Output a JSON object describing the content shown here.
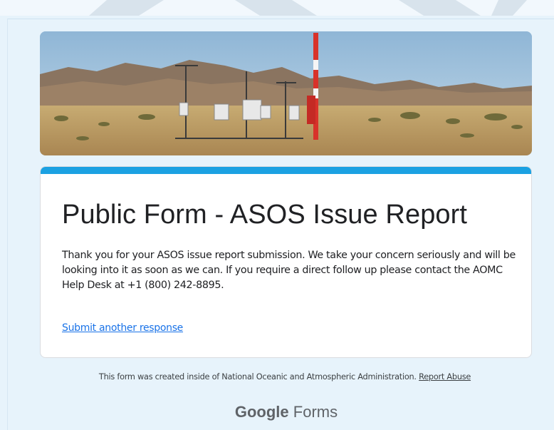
{
  "form": {
    "title": "Public Form - ASOS Issue Report",
    "confirmation_message": "Thank you for your ASOS issue report submission. We take your concern seriously and will be looking into it as soon as we can. If you require a direct follow up please contact the AOMC Help Desk at +1 (800) 242-8895.",
    "submit_another_label": "Submit another response",
    "accent_color": "#1ba1e2",
    "link_color": "#1a73e8"
  },
  "banner": {
    "image_icon": "weather-station-photo"
  },
  "footer": {
    "note": "This form was created inside of National Oceanic and Atmospheric Administration.",
    "report_abuse_label": "Report Abuse",
    "brand_primary": "Google",
    "brand_secondary": "Forms"
  },
  "colors": {
    "page_background": "#e7f3fb",
    "card_background": "#ffffff",
    "text_primary": "#202124",
    "text_secondary": "#5f6368"
  }
}
